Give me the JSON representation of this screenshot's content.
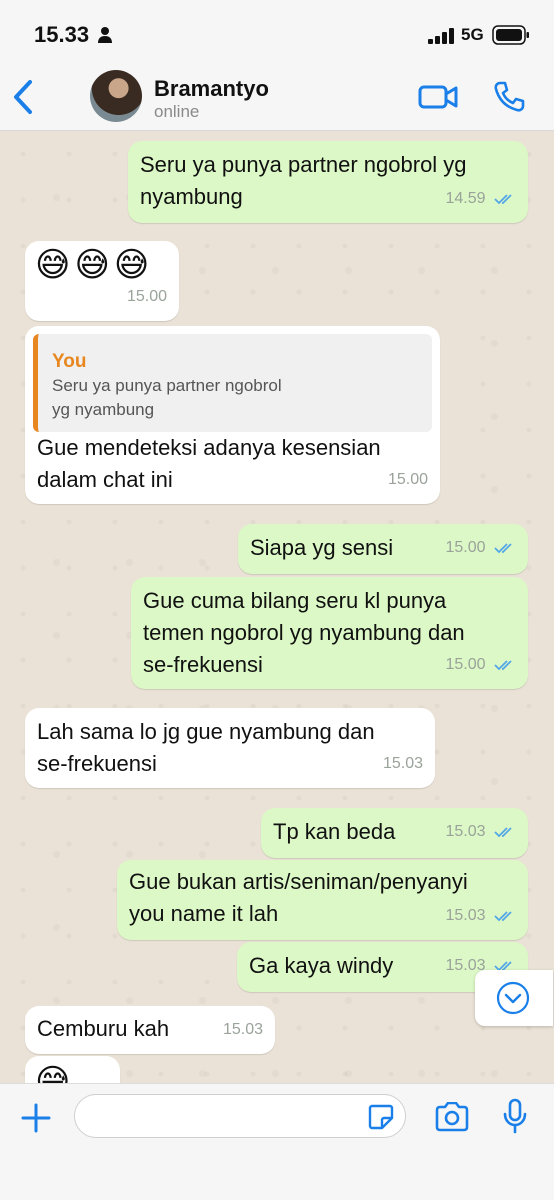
{
  "status": {
    "time": "15.33",
    "network": "5G"
  },
  "header": {
    "contact_name": "Bramantyo",
    "presence": "online"
  },
  "messages": [
    {
      "dir": "out",
      "text": "Seru ya punya partner ngobrol yg\nnyambung",
      "time": "14.59",
      "read": true
    },
    {
      "dir": "in",
      "text": "😅😅😅",
      "time": "15.00"
    },
    {
      "dir": "in",
      "quote_author": "You",
      "quote_text": "Seru ya punya partner ngobrol\nyg nyambung",
      "text": "Gue mendeteksi adanya kesensian\ndalam chat ini",
      "time": "15.00"
    },
    {
      "dir": "out",
      "text": "Siapa yg sensi",
      "time": "15.00",
      "read": true
    },
    {
      "dir": "out",
      "text": "Gue cuma bilang seru kl punya\ntemen ngobrol yg nyambung dan\nse-frekuensi",
      "time": "15.00",
      "read": true
    },
    {
      "dir": "in",
      "text": "Lah sama lo jg gue nyambung dan\nse-frekuensi",
      "time": "15.03"
    },
    {
      "dir": "out",
      "text": "Tp kan beda",
      "time": "15.03",
      "read": true
    },
    {
      "dir": "out",
      "text": "Gue bukan artis/seniman/penyanyi\nyou name it lah",
      "time": "15.03",
      "read": true
    },
    {
      "dir": "out",
      "text": "Ga kaya windy",
      "time": "15.03",
      "read": true
    },
    {
      "dir": "in",
      "text": "Cemburu kah",
      "time": "15.03"
    },
    {
      "dir": "in",
      "text": "😅",
      "time": ""
    }
  ],
  "composer": {
    "placeholder": ""
  },
  "colors": {
    "accent": "#1a7fe8",
    "outgoing": "#dcf8c6",
    "incoming": "#ffffff",
    "quote_author": "#e8861f",
    "ticks": "#53a6e8"
  },
  "icons": [
    "person-icon",
    "signal-icon",
    "battery-icon",
    "back-chevron-icon",
    "video-call-icon",
    "phone-icon",
    "chevron-down-icon",
    "plus-icon",
    "sticker-icon",
    "camera-icon",
    "microphone-icon",
    "double-check-icon"
  ]
}
